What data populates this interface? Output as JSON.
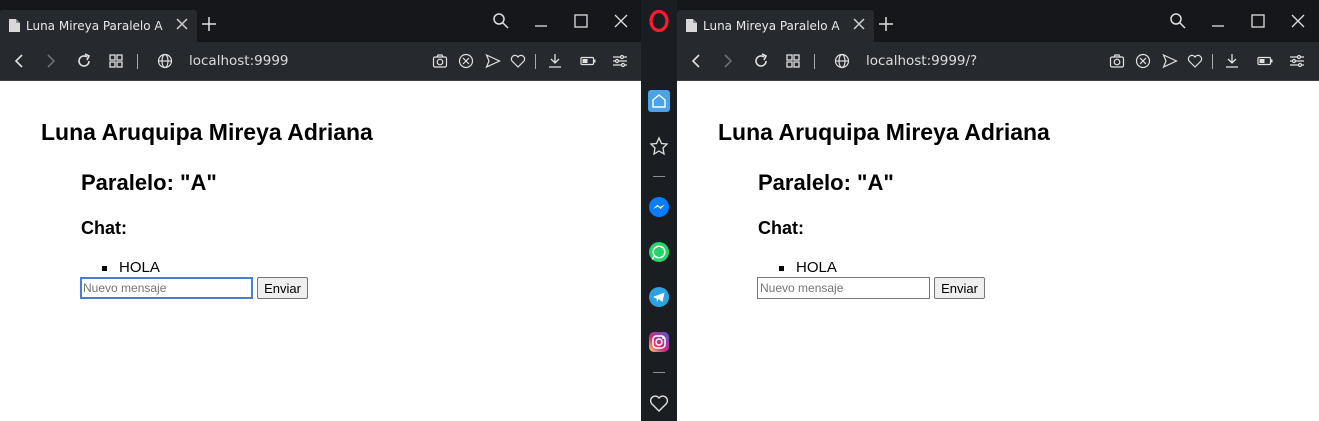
{
  "left_window": {
    "tab_title": "Luna Mireya Paralelo A",
    "url": "localhost:9999",
    "page": {
      "name_heading": "Luna Aruquipa Mireya Adriana",
      "paralelo_heading": "Paralelo: \"A\"",
      "chat_heading": "Chat:",
      "messages": [
        "HOLA"
      ],
      "input_placeholder": "Nuevo mensaje",
      "send_label": "Enviar"
    }
  },
  "right_window": {
    "tab_title": "Luna Mireya Paralelo A",
    "url": "localhost:9999/?",
    "page": {
      "name_heading": "Luna Aruquipa Mireya Adriana",
      "paralelo_heading": "Paralelo: \"A\"",
      "chat_heading": "Chat:",
      "messages": [
        "HOLA"
      ],
      "input_placeholder": "Nuevo mensaje",
      "send_label": "Enviar"
    }
  },
  "sidebar": {
    "items": [
      "opera-logo-icon",
      "home-icon",
      "bookmarks-icon",
      "messenger-icon",
      "whatsapp-icon",
      "telegram-icon",
      "instagram-icon",
      "heart-icon"
    ]
  },
  "colors": {
    "chrome_dark": "#15171a",
    "toolbar": "#262a2f",
    "opera_red": "#ff1b2d",
    "messenger_blue": "#0a7cff",
    "whatsapp_green": "#25d366",
    "telegram_blue": "#2aa3e0",
    "home_active": "#4aa3e8",
    "focus_blue": "#4a7fd0"
  }
}
